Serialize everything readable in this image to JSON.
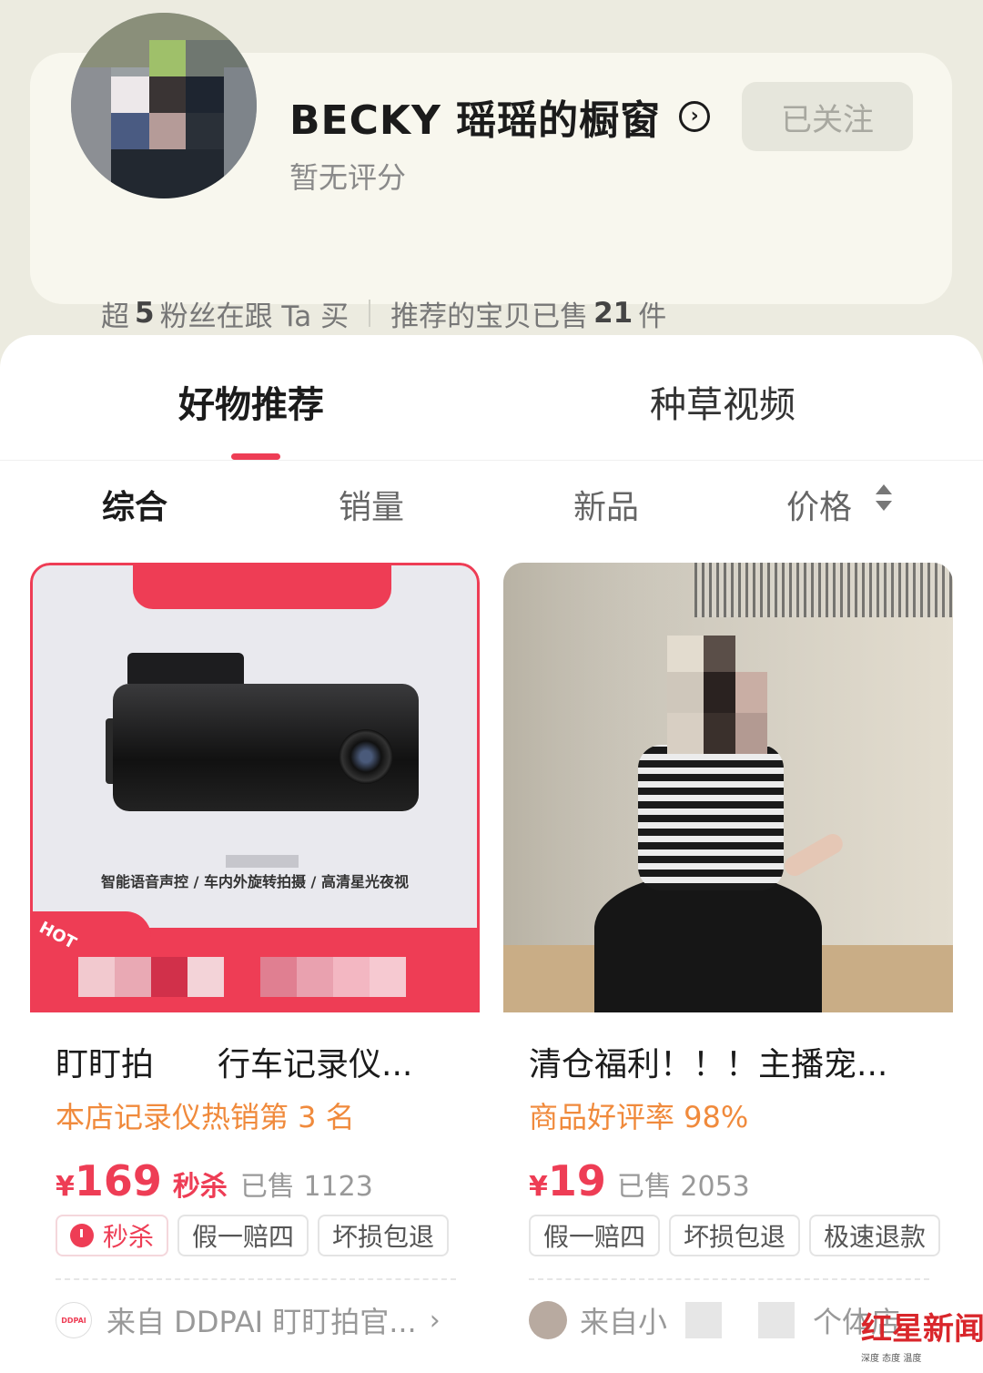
{
  "shop": {
    "name": "BECKY 瑶瑶的橱窗",
    "rating": "暂无评分",
    "follow_label": "已关注",
    "stats_prefix": "超",
    "fans_count": "5",
    "stats_fans_suffix": "粉丝在跟 Ta 买",
    "stats_sold_prefix": "推荐的宝贝已售",
    "sold_count": "21",
    "stats_sold_suffix": "件"
  },
  "tabs": [
    {
      "label": "好物推荐",
      "active": true
    },
    {
      "label": "种草视频",
      "active": false
    }
  ],
  "sort": [
    {
      "label": "综合",
      "active": true
    },
    {
      "label": "销量",
      "active": false
    },
    {
      "label": "新品",
      "active": false
    },
    {
      "label": "价格",
      "active": false
    }
  ],
  "products": [
    {
      "image_caption": "智能语音声控 / 车内外旋转拍摄 / 高清星光夜视",
      "hot_label": "HOT",
      "title_a": "盯盯拍",
      "title_b": "行车记录仪...",
      "highlight": "本店记录仪热销第 3 名",
      "currency": "¥",
      "price": "169",
      "flash_word": "秒杀",
      "sold": "已售 1123",
      "badges": [
        "秒杀",
        "假一赔四",
        "坏损包退"
      ],
      "brand_logo": "DDPAI",
      "source_a": "来自 DDPAI 盯盯拍官...",
      "source_b": ""
    },
    {
      "title": "清仓福利！！！主播宠...",
      "highlight": "商品好评率 98%",
      "currency": "¥",
      "price": "19",
      "sold": "已售 2053",
      "badges": [
        "假一赔四",
        "坏损包退",
        "极速退款"
      ],
      "source_a": "来自小",
      "source_b": "个体店"
    }
  ],
  "watermark": {
    "main": "红星新闻",
    "sub": "深度 态度 温度"
  },
  "colors": {
    "accent": "#ee3d55",
    "highlight": "#f08a3c",
    "page_bg": "#ecebe0"
  }
}
